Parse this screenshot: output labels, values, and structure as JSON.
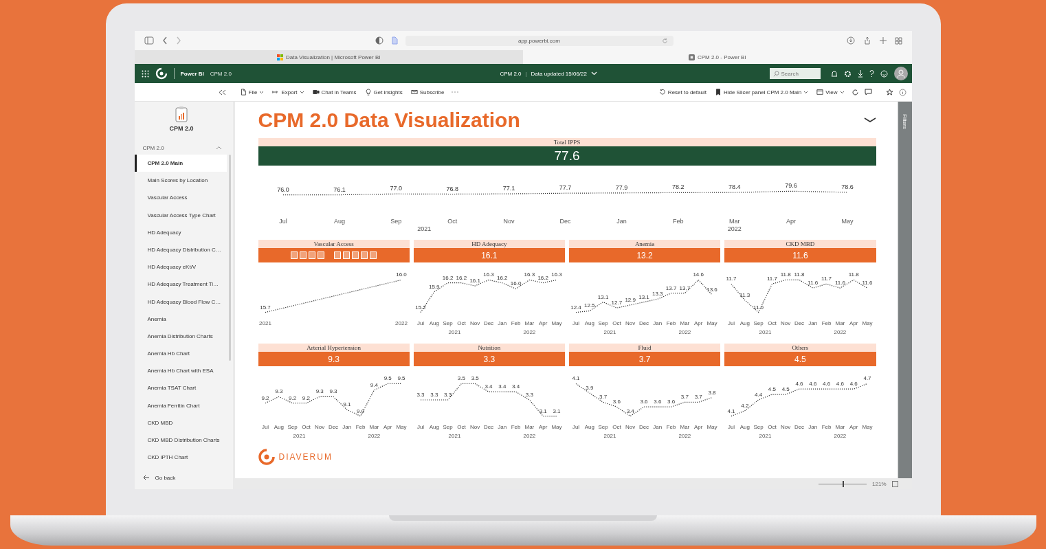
{
  "browser": {
    "address": "app.powerbi.com",
    "tabs": [
      {
        "title": "Data Visualization | Microsoft Power BI",
        "kind": "microsoft",
        "selected": false
      },
      {
        "title": "CPM 2.0 - Power BI",
        "kind": "powerbi",
        "selected": true
      }
    ]
  },
  "app_header": {
    "product": "Power BI",
    "workspace": "CPM 2.0",
    "report": "CPM 2.0",
    "separator": "|",
    "updated": "Data updated 15/06/22",
    "search": {
      "placeholder": "Search"
    }
  },
  "toolbar": {
    "items": [
      {
        "label": "File",
        "kind": "file",
        "dropdown": true
      },
      {
        "label": "Export",
        "kind": "export",
        "dropdown": true
      },
      {
        "label": "Chat in Teams",
        "kind": "teams",
        "dropdown": false
      },
      {
        "label": "Get insights",
        "kind": "bulb",
        "dropdown": false
      },
      {
        "label": "Subscribe",
        "kind": "mail",
        "dropdown": false
      }
    ],
    "right_items": [
      {
        "label": "Reset to default",
        "kind": "reset",
        "dropdown": false
      },
      {
        "label": "Hide Slicer panel CPM 2.0 Main",
        "kind": "bookmark",
        "dropdown": true
      },
      {
        "label": "View",
        "kind": "view",
        "dropdown": true
      }
    ]
  },
  "sidebar": {
    "app_name": "CPM 2.0",
    "section": {
      "label": "CPM 2.0",
      "expanded": true
    },
    "items": [
      {
        "label": "CPM 2.0 Main",
        "selected": true
      },
      {
        "label": "Main Scores by Location",
        "selected": false
      },
      {
        "label": "Vascular Access",
        "selected": false
      },
      {
        "label": "Vascular Access Type Chart",
        "selected": false
      },
      {
        "label": "HD Adequacy",
        "selected": false
      },
      {
        "label": "HD Adequacy Distribution C…",
        "selected": false
      },
      {
        "label": "HD Adequacy eKt/V",
        "selected": false
      },
      {
        "label": "HD Adequacy Treatment Ti…",
        "selected": false
      },
      {
        "label": "HD Adequacy Blood Flow C…",
        "selected": false
      },
      {
        "label": "Anemia",
        "selected": false
      },
      {
        "label": "Anemia Distribution Charts",
        "selected": false
      },
      {
        "label": "Anemia Hb Chart",
        "selected": false
      },
      {
        "label": "Anemia Hb Chart with ESA",
        "selected": false
      },
      {
        "label": "Anemia TSAT Chart",
        "selected": false
      },
      {
        "label": "Anemia Ferritin Chart",
        "selected": false
      },
      {
        "label": "CKD MBD",
        "selected": false
      },
      {
        "label": "CKD MBD Distribution Charts",
        "selected": false
      },
      {
        "label": "CKD iPTH Chart",
        "selected": false
      }
    ],
    "back": "Go back"
  },
  "report": {
    "title": "CPM 2.0 Data Visualization",
    "total": {
      "label": "Total IPPS",
      "value": "77.6",
      "years": [
        "2021",
        "2022"
      ],
      "chart_data": {
        "type": "line",
        "categories": [
          "Jul",
          "Aug",
          "Sep",
          "Oct",
          "Nov",
          "Dec",
          "Jan",
          "Feb",
          "Mar",
          "Apr",
          "May"
        ],
        "data_labels": true,
        "series": [
          {
            "color": "#333333",
            "line_style": "dotted",
            "values": [
              76.0,
              76.1,
              77.0,
              76.8,
              77.1,
              77.7,
              77.9,
              78.2,
              78.4,
              79.6,
              78.6
            ],
            "value_labels": [
              "76.0",
              "76.1",
              "77.0",
              "76.8",
              "77.1",
              "77.7",
              "77.9",
              "78.2",
              "78.4",
              "79.6",
              "78.6"
            ]
          }
        ]
      }
    },
    "panels": [
      {
        "label": "Vascular Access",
        "toolbar_visible": true,
        "chart_data": {
          "type": "line",
          "categories": [
            "2021",
            "2022"
          ],
          "data_labels": true,
          "series": [
            {
              "color": "#333333",
              "line_style": "dotted",
              "values": [
                15.7,
                16.0
              ],
              "value_labels": [
                "15.7",
                "16.0"
              ]
            }
          ]
        }
      },
      {
        "label": "HD Adequacy",
        "value": "16.1",
        "toolbar_visible": false,
        "years": [
          "2021",
          "2022"
        ],
        "chart_data": {
          "type": "line",
          "categories": [
            "Jul",
            "Aug",
            "Sep",
            "Oct",
            "Nov",
            "Dec",
            "Jan",
            "Feb",
            "Mar",
            "Apr",
            "May"
          ],
          "data_labels": true,
          "series": [
            {
              "color": "#333333",
              "line_style": "dotted",
              "values": [
                15.2,
                15.9,
                16.2,
                16.2,
                16.1,
                16.3,
                16.2,
                16.0,
                16.3,
                16.2,
                16.3
              ],
              "value_labels": [
                "15.2",
                "15.9",
                "16.2",
                "16.2",
                "16.1",
                "16.3",
                "16.2",
                "16.0",
                "16.3",
                "16.2",
                "16.3"
              ]
            }
          ]
        }
      },
      {
        "label": "Anemia",
        "value": "13.2",
        "toolbar_visible": false,
        "years": [
          "2021",
          "2022"
        ],
        "chart_data": {
          "type": "line",
          "categories": [
            "Jul",
            "Aug",
            "Sep",
            "Oct",
            "Nov",
            "Dec",
            "Jan",
            "Feb",
            "Mar",
            "Apr",
            "May"
          ],
          "data_labels": true,
          "series": [
            {
              "color": "#333333",
              "line_style": "dotted",
              "values": [
                12.4,
                12.5,
                13.1,
                12.7,
                12.9,
                13.1,
                13.3,
                13.7,
                13.7,
                14.6,
                13.6
              ],
              "value_labels": [
                "12.4",
                "12.5",
                "13.1",
                "12.7",
                "12.9",
                "13.1",
                "13.3",
                "13.7",
                "13.7",
                "14.6",
                "13.6"
              ]
            }
          ]
        }
      },
      {
        "label": "CKD MBD",
        "value": "11.6",
        "toolbar_visible": false,
        "years": [
          "2021",
          "2022"
        ],
        "chart_data": {
          "type": "line",
          "categories": [
            "Jul",
            "Aug",
            "Sep",
            "Oct",
            "Nov",
            "Dec",
            "Jan",
            "Feb",
            "Mar",
            "Apr",
            "May"
          ],
          "data_labels": true,
          "series": [
            {
              "color": "#333333",
              "line_style": "dotted",
              "values": [
                11.7,
                11.3,
                11.0,
                11.7,
                11.8,
                11.8,
                11.6,
                11.7,
                11.6,
                11.8,
                11.6
              ],
              "value_labels": [
                "11.7",
                "11.3",
                "11.0",
                "11.7",
                "11.8",
                "11.8",
                "11.6",
                "11.7",
                "11.6",
                "11.8",
                "11.6"
              ]
            }
          ]
        }
      },
      {
        "label": "Arterial Hypertension",
        "value": "9.3",
        "toolbar_visible": false,
        "years": [
          "2021",
          "2022"
        ],
        "chart_data": {
          "type": "line",
          "categories": [
            "Jul",
            "Aug",
            "Sep",
            "Oct",
            "Nov",
            "Dec",
            "Jan",
            "Feb",
            "Mar",
            "Apr",
            "May"
          ],
          "data_labels": true,
          "series": [
            {
              "color": "#333333",
              "line_style": "dotted",
              "values": [
                9.2,
                9.3,
                9.2,
                9.2,
                9.3,
                9.3,
                9.1,
                9.0,
                9.4,
                9.5,
                9.5
              ],
              "value_labels": [
                "9.2",
                "9.3",
                "9.2",
                "9.2",
                "9.3",
                "9.3",
                "9.1",
                "9.0",
                "9.4",
                "9.5",
                "9.5"
              ]
            }
          ]
        }
      },
      {
        "label": "Nutrition",
        "value": "3.3",
        "toolbar_visible": false,
        "years": [
          "2021",
          "2022"
        ],
        "chart_data": {
          "type": "line",
          "categories": [
            "Jul",
            "Aug",
            "Sep",
            "Oct",
            "Nov",
            "Dec",
            "Jan",
            "Feb",
            "Mar",
            "Apr",
            "May"
          ],
          "data_labels": true,
          "series": [
            {
              "color": "#333333",
              "line_style": "dotted",
              "values": [
                3.3,
                3.3,
                3.3,
                3.5,
                3.5,
                3.4,
                3.4,
                3.4,
                3.3,
                3.1,
                3.1
              ],
              "value_labels": [
                "3.3",
                "3.3",
                "3.3",
                "3.5",
                "3.5",
                "3.4",
                "3.4",
                "3.4",
                "3.3",
                "3.1",
                "3.1"
              ]
            }
          ]
        }
      },
      {
        "label": "Fluid",
        "value": "3.7",
        "toolbar_visible": false,
        "years": [
          "2021",
          "2022"
        ],
        "chart_data": {
          "type": "line",
          "categories": [
            "Jul",
            "Aug",
            "Sep",
            "Oct",
            "Nov",
            "Dec",
            "Jan",
            "Feb",
            "Mar",
            "Apr",
            "May"
          ],
          "data_labels": true,
          "series": [
            {
              "color": "#333333",
              "line_style": "dotted",
              "values": [
                4.1,
                3.9,
                3.7,
                3.6,
                3.4,
                3.6,
                3.6,
                3.6,
                3.7,
                3.7,
                3.8
              ],
              "value_labels": [
                "4.1",
                "3.9",
                "3.7",
                "3.6",
                "3.4",
                "3.6",
                "3.6",
                "3.6",
                "3.7",
                "3.7",
                "3.8"
              ]
            }
          ]
        }
      },
      {
        "label": "Others",
        "value": "4.5",
        "toolbar_visible": false,
        "years": [
          "2021",
          "2022"
        ],
        "chart_data": {
          "type": "line",
          "categories": [
            "Jul",
            "Aug",
            "Sep",
            "Oct",
            "Nov",
            "Dec",
            "Jan",
            "Feb",
            "Mar",
            "Apr",
            "May"
          ],
          "data_labels": true,
          "series": [
            {
              "color": "#333333",
              "line_style": "dotted",
              "values": [
                4.1,
                4.2,
                4.4,
                4.5,
                4.5,
                4.6,
                4.6,
                4.6,
                4.6,
                4.6,
                4.7
              ],
              "value_labels": [
                "4.1",
                "4.2",
                "4.4",
                "4.5",
                "4.5",
                "4.6",
                "4.6",
                "4.6",
                "4.6",
                "4.6",
                "4.7"
              ]
            }
          ]
        }
      }
    ],
    "logo": "DIAVERUM"
  },
  "filters_pane": {
    "label": "Filters"
  },
  "zoom": {
    "level": 0.5,
    "reading": "121%"
  }
}
